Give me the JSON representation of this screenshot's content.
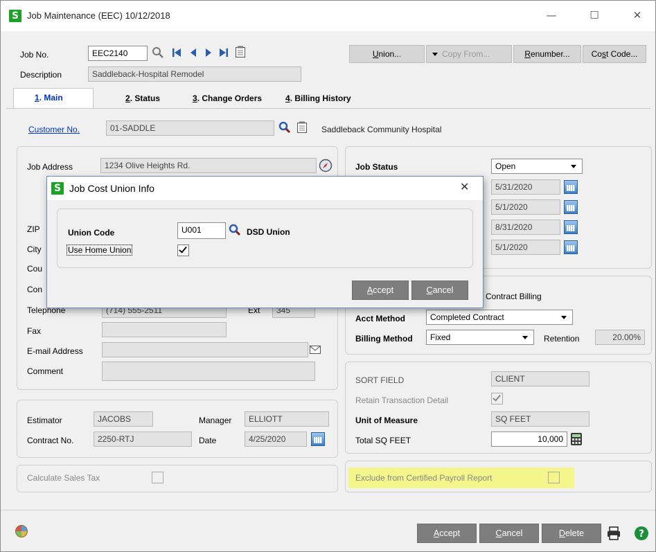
{
  "window": {
    "title": "Job Maintenance (EEC) 10/12/2018",
    "logo_letter": "S",
    "minimize": "—",
    "maximize": "☐",
    "close": "✕"
  },
  "header": {
    "job_no_label": "Job No.",
    "job_no_value": "EEC2140",
    "description_label": "Description",
    "description_value": "Saddleback-Hospital Remodel"
  },
  "toolbar": {
    "union_prefix": "U",
    "union_rest": "nion...",
    "copy_from": "Copy From...",
    "renumber_prefix": "R",
    "renumber_rest": "enumber...",
    "cost_code_a": "Co",
    "cost_code_u": "s",
    "cost_code_b": "t Code..."
  },
  "tabs": [
    {
      "num": "1",
      "label": ". Main"
    },
    {
      "num": "2",
      "label": ". Status"
    },
    {
      "num": "3",
      "label": ". Change Orders"
    },
    {
      "num": "4",
      "label": ". Billing History"
    }
  ],
  "customer": {
    "label": "Customer No.",
    "value": "01-SADDLE",
    "name": "Saddleback Community Hospital"
  },
  "address": {
    "job_address_label": "Job Address",
    "job_address_value": "1234 Olive Heights Rd.",
    "zip_label": "ZIP",
    "city_label": "City",
    "county_label": "Cou",
    "contact_label": "Con",
    "telephone_label": "Telephone",
    "telephone_value": "(714) 555-2511",
    "ext_label": "Ext",
    "ext_value": "345",
    "fax_label": "Fax",
    "email_label": "E-mail Address",
    "comment_label": "Comment"
  },
  "people": {
    "estimator_label": "Estimator",
    "estimator_value": "JACOBS",
    "manager_label": "Manager",
    "manager_value": "ELLIOTT",
    "contract_label": "Contract No.",
    "contract_value": "2250-RTJ",
    "date_label": "Date",
    "date_value": "4/25/2020"
  },
  "sales_tax": {
    "label": "Calculate Sales Tax"
  },
  "status": {
    "job_status_label": "Job Status",
    "job_status_value": "Open",
    "dates": [
      "5/31/2020",
      "5/1/2020",
      "8/31/2020",
      "5/1/2020"
    ]
  },
  "billing": {
    "contract_billing_label": "Contract Billing",
    "acct_method_label": "Acct Method",
    "acct_method_value": "Completed Contract",
    "billing_method_label": "Billing Method",
    "billing_method_value": "Fixed",
    "retention_label": "Retention",
    "retention_value": "20.00%"
  },
  "sort": {
    "sort_field_label": "SORT FIELD",
    "sort_field_value": "CLIENT",
    "retain_label": "Retain Transaction Detail",
    "uom_label": "Unit of Measure",
    "uom_value": "SQ FEET",
    "total_label": "Total SQ FEET",
    "total_value": "10,000"
  },
  "certified": {
    "label": "Exclude from Certified Payroll Report"
  },
  "footer": {
    "accept_u": "A",
    "accept_rest": "ccept",
    "cancel_u": "C",
    "cancel_rest": "ancel",
    "delete_u": "D",
    "delete_rest": "elete"
  },
  "dialog": {
    "title": "Job Cost Union Info",
    "close": "✕",
    "union_code_label": "Union Code",
    "union_code_value": "U001",
    "union_name": "DSD Union",
    "use_home_label": "Use Home Union",
    "accept_u": "A",
    "accept_rest": "ccept",
    "cancel_u": "C",
    "cancel_rest": "ancel"
  },
  "colors": {
    "sage_green": "#1aa324",
    "highlight": "#f4f58a",
    "button_gray": "#7e7e7e",
    "link_blue": "#0033cc"
  }
}
